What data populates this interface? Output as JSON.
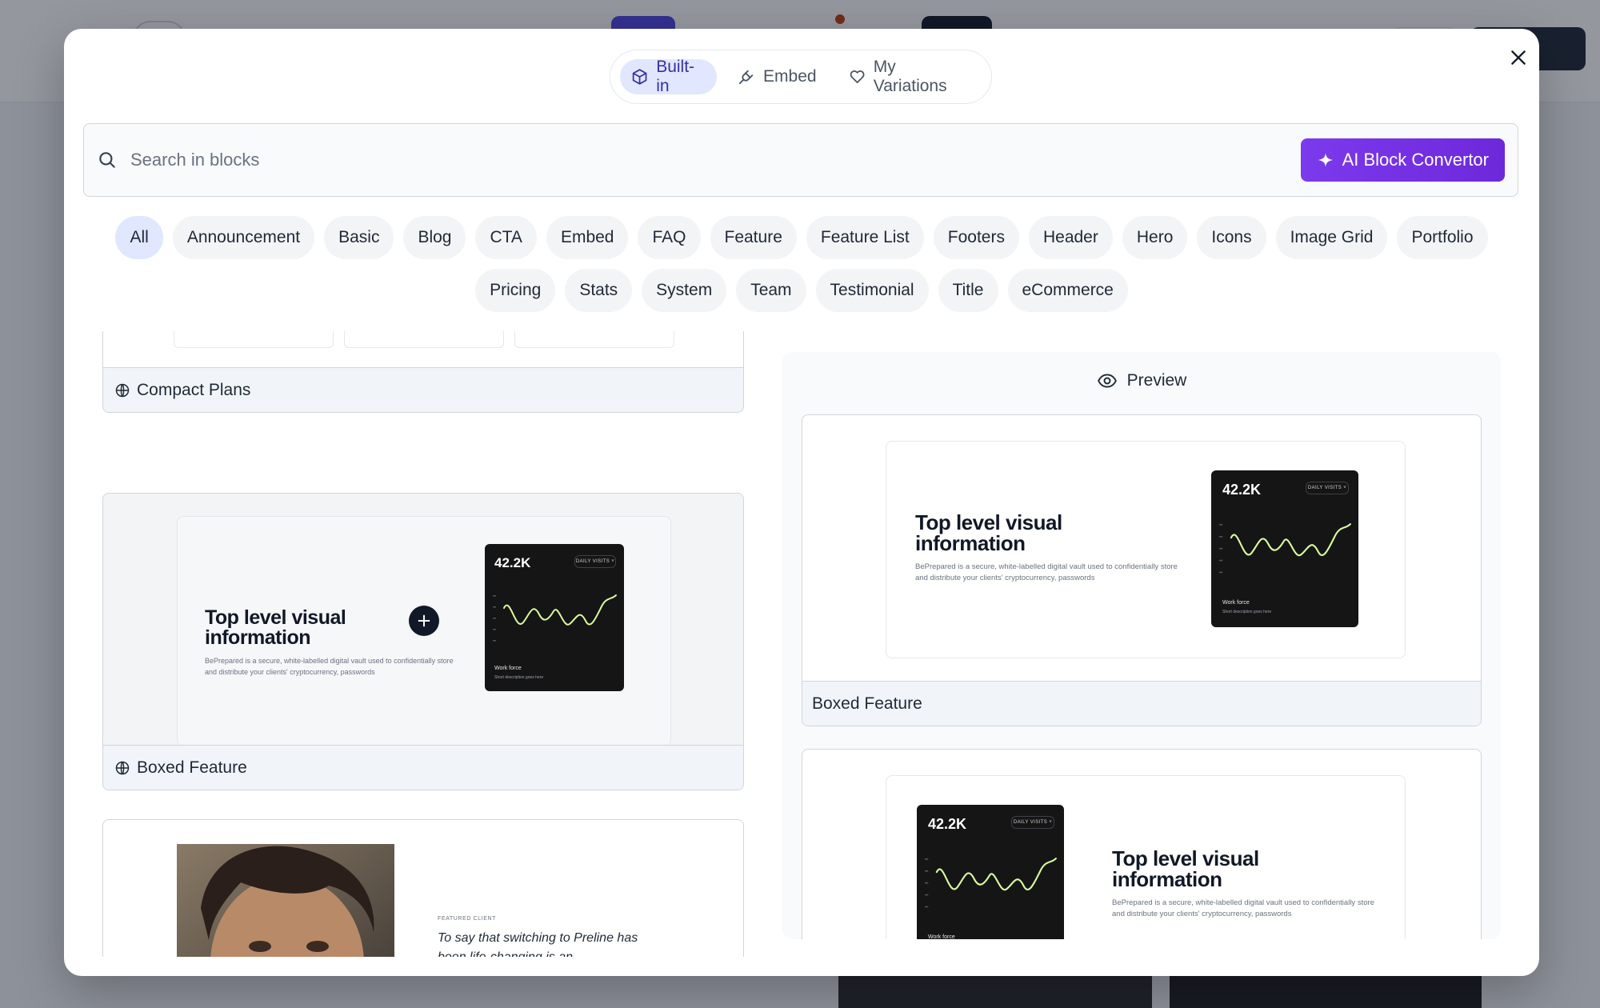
{
  "tabs": [
    {
      "label": "Built-in",
      "icon": "cube-icon",
      "active": true
    },
    {
      "label": "Embed",
      "icon": "plug-icon",
      "active": false
    },
    {
      "label": "My Variations",
      "icon": "heart-icon",
      "active": false
    }
  ],
  "search": {
    "placeholder": "Search in blocks",
    "value": ""
  },
  "ai_button": {
    "label": "AI Block Convertor",
    "icon": "sparkle-icon"
  },
  "categories": [
    "All",
    "Announcement",
    "Basic",
    "Blog",
    "CTA",
    "Embed",
    "FAQ",
    "Feature",
    "Feature List",
    "Footers",
    "Header",
    "Hero",
    "Icons",
    "Image Grid",
    "Portfolio",
    "Pricing",
    "Stats",
    "System",
    "Team",
    "Testimonial",
    "Title",
    "eCommerce"
  ],
  "active_category": "All",
  "blocks": {
    "compact_plans": {
      "label": "Compact Plans"
    },
    "boxed_feature": {
      "label": "Boxed Feature",
      "title": "Top level visual information",
      "desc": "BePrepared is a secure, white-labelled digital vault used to confidentially store and distribute your clients' cryptocurrency, passwords",
      "stat": "42.2K",
      "badge": "DAILY VISITS ˅",
      "work_force": "Work force",
      "short_desc": "Short description goes here"
    },
    "testimonial": {
      "eyebrow": "FEATURED CLIENT",
      "quote": "To say that switching to Preline has been life-changing is an understatement. My business has"
    }
  },
  "preview": {
    "heading": "Preview",
    "card1_label": "Boxed Feature"
  },
  "colors": {
    "accent": "#6d28d9",
    "active_tab_bg": "#e0e7ff",
    "chart_line": "#d9f99d"
  }
}
